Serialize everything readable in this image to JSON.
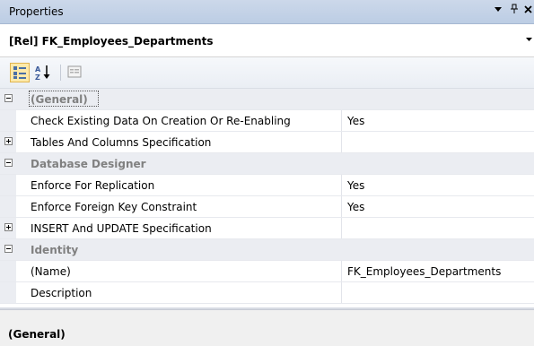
{
  "window": {
    "title": "Properties",
    "dropdown_glyph": "▾",
    "pin_glyph": "ᵖ",
    "close_glyph": "×"
  },
  "object_selector": {
    "value": "[Rel] FK_Employees_Departments"
  },
  "toolbar": {
    "buttons": [
      {
        "name": "categorized-icon",
        "selected": true
      },
      {
        "name": "alphabetical-icon",
        "selected": false
      },
      {
        "name": "property-pages-icon",
        "selected": false
      }
    ]
  },
  "grid": {
    "rows": [
      {
        "type": "category",
        "label": "(General)",
        "expanded": true,
        "focused": true
      },
      {
        "type": "property",
        "label": "Check Existing Data On Creation Or Re-Enabling",
        "value": "Yes"
      },
      {
        "type": "expandable",
        "label": "Tables And Columns Specification",
        "value": ""
      },
      {
        "type": "category",
        "label": "Database Designer",
        "expanded": true
      },
      {
        "type": "property",
        "label": "Enforce For Replication",
        "value": "Yes"
      },
      {
        "type": "property",
        "label": "Enforce Foreign Key Constraint",
        "value": "Yes"
      },
      {
        "type": "expandable",
        "label": "INSERT And UPDATE Specification",
        "value": ""
      },
      {
        "type": "category",
        "label": "Identity",
        "expanded": true
      },
      {
        "type": "property",
        "label": "(Name)",
        "value": "FK_Employees_Departments"
      },
      {
        "type": "property",
        "label": "Description",
        "value": ""
      }
    ]
  },
  "description": {
    "title": "(General)"
  }
}
